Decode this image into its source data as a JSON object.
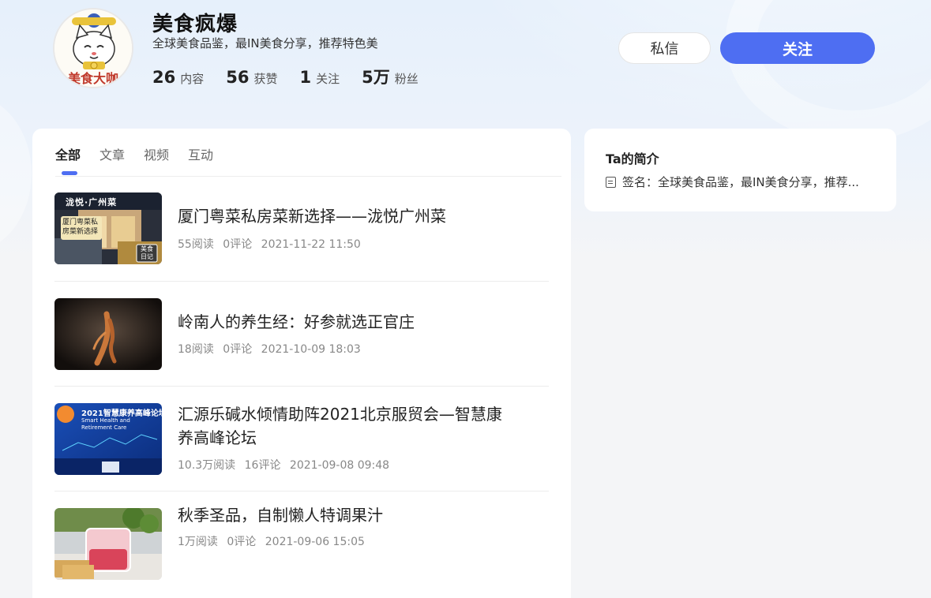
{
  "profile": {
    "name": "美食疯爆",
    "bio": "全球美食品鉴，最IN美食分享，推荐特色美",
    "avatar_text": "美食大咖",
    "stats": [
      {
        "num": "26",
        "label": "内容"
      },
      {
        "num": "56",
        "label": "获赞"
      },
      {
        "num": "1",
        "label": "关注"
      },
      {
        "num": "5万",
        "label": "粉丝"
      }
    ]
  },
  "actions": {
    "message": "私信",
    "follow": "关注"
  },
  "tabs": [
    {
      "label": "全部",
      "active": true
    },
    {
      "label": "文章"
    },
    {
      "label": "视频"
    },
    {
      "label": "互动"
    }
  ],
  "articles": [
    {
      "title": "厦门粤菜私房菜新选择——泷悦广州菜",
      "reads": "55阅读",
      "comments": "0评论",
      "time": "2021-11-22 11:50",
      "thumb_text": "泷悦·广州菜",
      "thumb_sign": "厦门粤菜私房菜新选择",
      "thumb_badge": "美食日记"
    },
    {
      "title": "岭南人的养生经：好参就选正官庄",
      "reads": "18阅读",
      "comments": "0评论",
      "time": "2021-10-09 18:03"
    },
    {
      "title": "汇源乐碱水倾情助阵2021北京服贸会—智慧康养高峰论坛",
      "reads": "10.3万阅读",
      "comments": "16评论",
      "time": "2021-09-08 09:48",
      "thumb_text": "2021智慧康养高峰论坛",
      "thumb_sub": "Smart Health and Retirement Care"
    },
    {
      "title": "秋季圣品，自制懒人特调果汁",
      "reads": "1万阅读",
      "comments": "0评论",
      "time": "2021-09-06 15:05"
    }
  ],
  "intro": {
    "title": "Ta的简介",
    "sign": "签名：全球美食品鉴，最IN美食分享，推荐..."
  },
  "colors": {
    "accent": "#4e6ef2",
    "bg": "#f4f5f7"
  }
}
